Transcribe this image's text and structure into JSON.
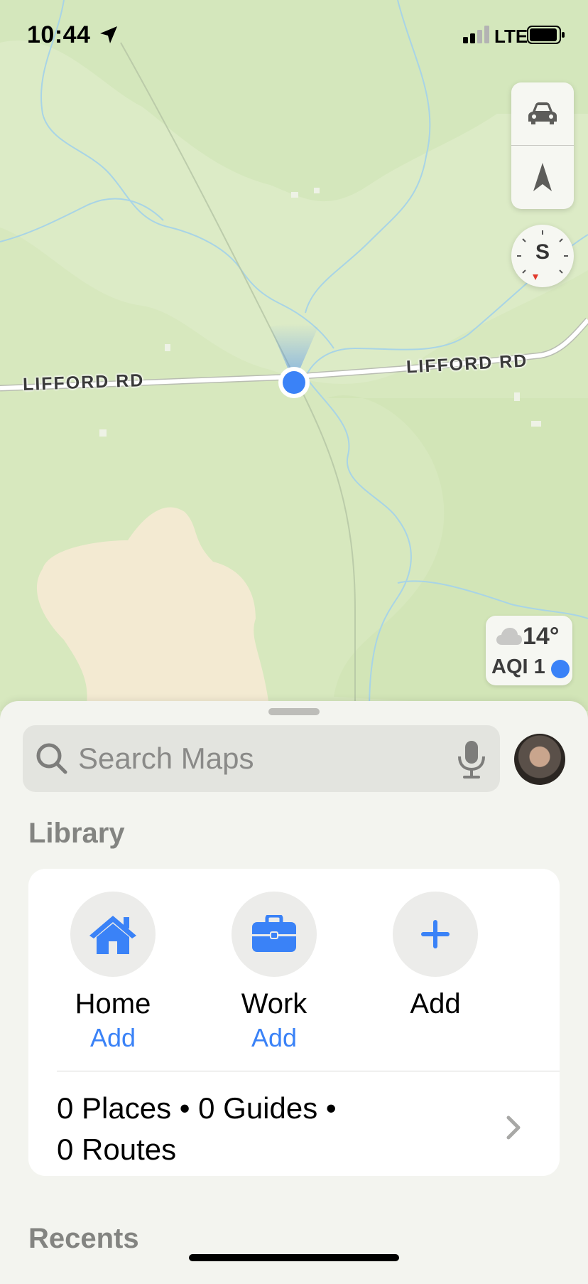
{
  "status_bar": {
    "time": "10:44",
    "network": "LTE"
  },
  "map": {
    "road_left_label": "LIFFORD RD",
    "road_right_label": "LIFFORD RD",
    "controls": {
      "drive_icon": "car-icon",
      "tracking_icon": "location-arrow-icon"
    },
    "compass_heading": "S"
  },
  "weather": {
    "temperature": "14°",
    "aqi": "AQI 1",
    "icon": "cloud-icon",
    "aqi_color": "#3a82f7"
  },
  "search": {
    "placeholder": "Search Maps"
  },
  "library": {
    "title": "Library",
    "items": [
      {
        "label": "Home",
        "action": "Add",
        "icon": "house-icon"
      },
      {
        "label": "Work",
        "action": "Add",
        "icon": "briefcase-icon"
      },
      {
        "label": "Add",
        "action": "",
        "icon": "plus-icon"
      }
    ],
    "summary_line1": "0 Places • 0 Guides •",
    "summary_line2": "0 Routes"
  },
  "recents": {
    "title": "Recents"
  },
  "colors": {
    "accent": "#3a82f7",
    "map_green": "#dcebc6"
  }
}
